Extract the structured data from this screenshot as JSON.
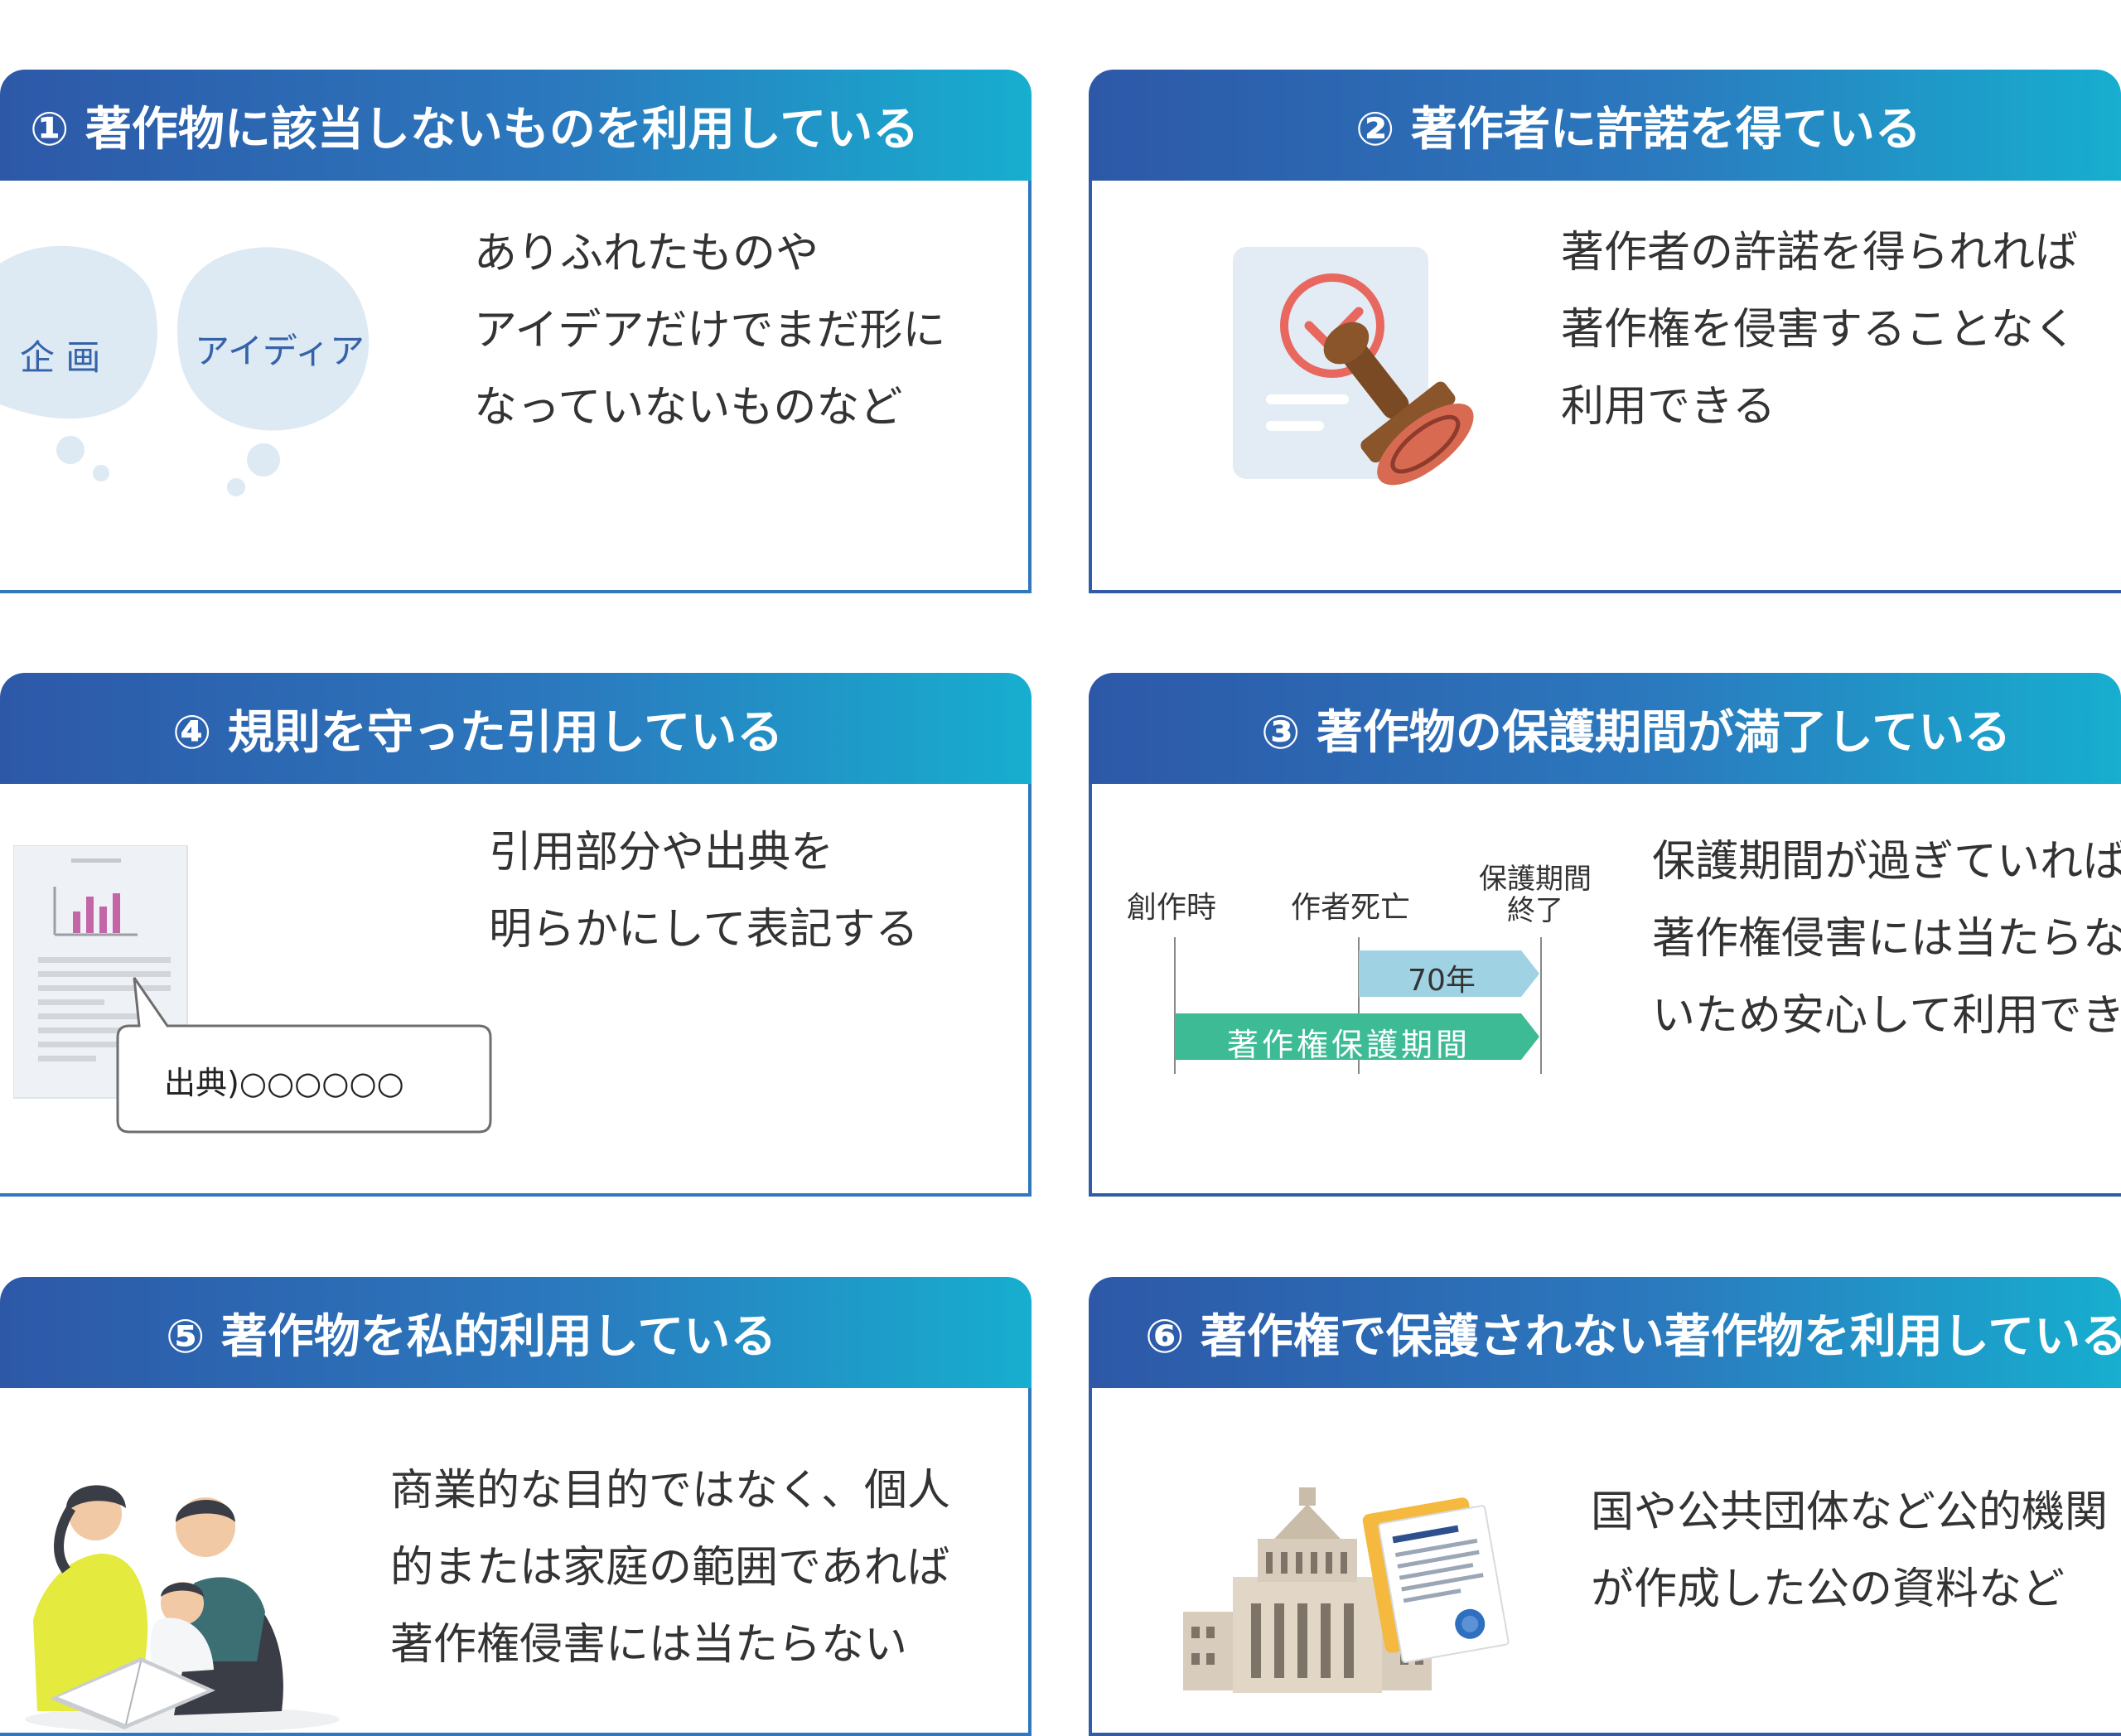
{
  "cards": {
    "c1": {
      "title": "① 著作物に該当しないものを利用している",
      "bubble_left": "企 画",
      "bubble_right": "アイディア",
      "lines": [
        "ありふれたものや",
        "アイデアだけでまだ形に",
        "なっていないものなど"
      ]
    },
    "c2": {
      "title": "② 著作者に許諾を得ている",
      "lines": [
        "著作者の許諾を得られれば",
        "著作権を侵害することなく",
        "利用できる"
      ]
    },
    "c4": {
      "title": "④ 規則を守った引用している",
      "citation_label": "出典)○○○○○○",
      "lines": [
        "引用部分や出典を",
        "明らかにして表記する"
      ]
    },
    "c3": {
      "title": "③ 著作物の保護期間が満了している",
      "timeline": {
        "label_creation": "創作時",
        "label_death": "作者死亡",
        "label_end_1": "保護期間",
        "label_end_2": "終了",
        "arrow_years": "70年",
        "arrow_period": "著作権保護期間"
      },
      "lines": [
        "保護期間が過ぎていれば",
        "著作権侵害には当たらな",
        "いため安心して利用できる"
      ]
    },
    "c5": {
      "title": "⑤ 著作物を私的利用している",
      "lines": [
        "商業的な目的ではなく、個人",
        "的または家庭の範囲であれば",
        "著作権侵害には当たらない"
      ]
    },
    "c6": {
      "title": "⑥ 著作権で保護されない著作物を利用している",
      "lines": [
        "国や公共団体など公的機関",
        "が作成した公の資料など"
      ]
    }
  },
  "colors": {
    "header_start": "#2d58a8",
    "header_end": "#17aecf",
    "arrow_years": "#9fd2e3",
    "arrow_period": "#3cbb95",
    "check_red": "#e8675f",
    "bubble": "#dde9f3"
  },
  "icons": {
    "bubbles": "thought-bubbles-icon",
    "stamp": "approval-stamp-icon",
    "document": "report-document-icon",
    "family": "family-reading-icon",
    "parliament": "parliament-building-icon"
  }
}
